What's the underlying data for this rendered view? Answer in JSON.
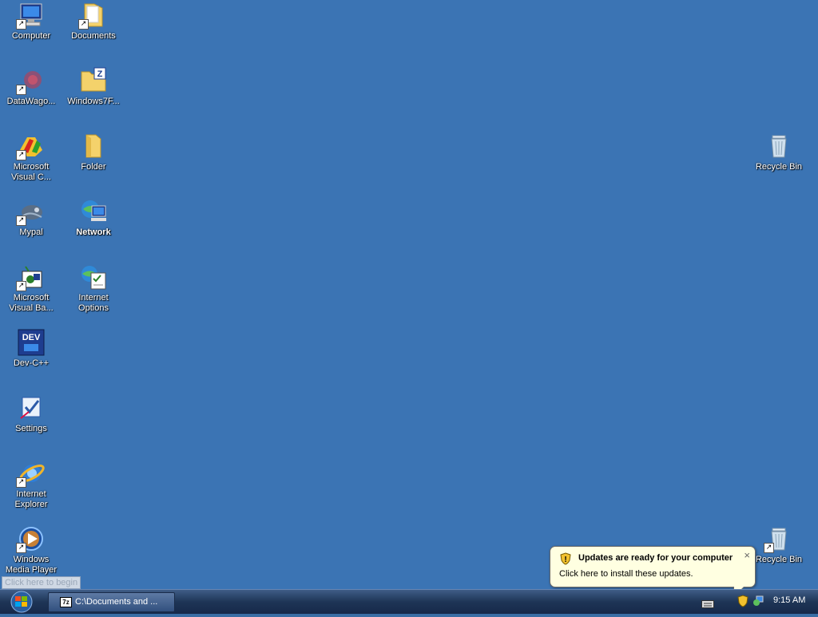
{
  "desktop_icons": [
    {
      "id": "computer",
      "label": "Computer"
    },
    {
      "id": "documents",
      "label": "Documents"
    },
    {
      "id": "datawago",
      "label": "DataWago..."
    },
    {
      "id": "windows7f",
      "label": "Windows7F..."
    },
    {
      "id": "msvc",
      "label": "Microsoft Visual C..."
    },
    {
      "id": "folder",
      "label": "Folder"
    },
    {
      "id": "mypal",
      "label": "Mypal"
    },
    {
      "id": "network",
      "label": "Network"
    },
    {
      "id": "msvb",
      "label": "Microsoft Visual Ba..."
    },
    {
      "id": "internet-options",
      "label": "Internet Options"
    },
    {
      "id": "devcpp",
      "label": "Dev-C++"
    },
    {
      "id": "settings",
      "label": "Settings"
    },
    {
      "id": "ie",
      "label": "Internet Explorer"
    },
    {
      "id": "wmp",
      "label": "Windows Media Player"
    },
    {
      "id": "recycle1",
      "label": "Recycle Bin"
    },
    {
      "id": "recycle2",
      "label": "Recycle Bin"
    }
  ],
  "start_tooltip": "Click here to begin",
  "taskbar": {
    "task_button_label": "C:\\Documents and ...",
    "task_app_badge": "7z",
    "clock": "9:15 AM"
  },
  "balloon": {
    "title": "Updates are ready for your computer",
    "body": "Click here to install these updates.",
    "close": "×"
  },
  "icons": {
    "start": "windows-orb-icon",
    "keyboard": "keyboard-icon",
    "update": "shield-update-icon",
    "network": "network-tray-icon"
  }
}
